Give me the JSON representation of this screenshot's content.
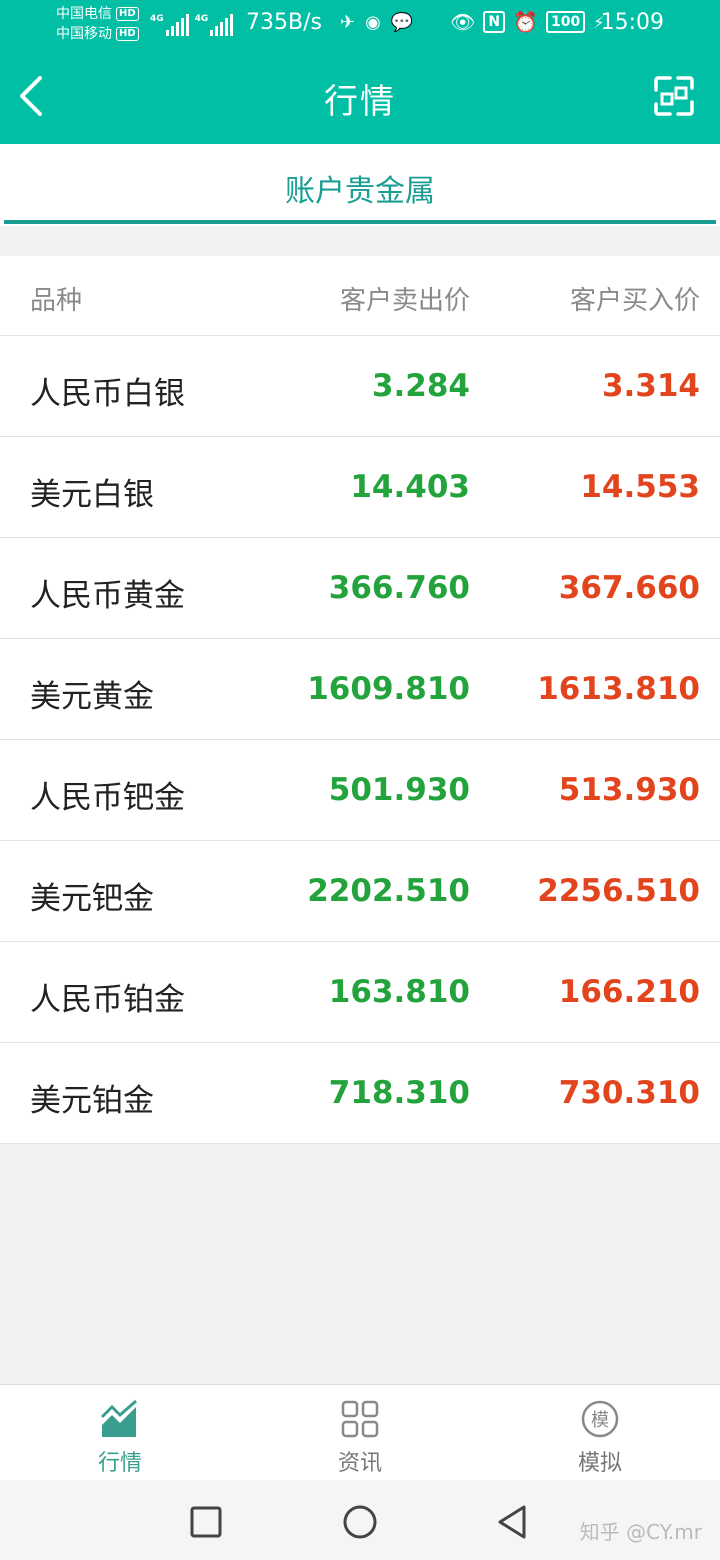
{
  "status_bar": {
    "carrier1": "中国电信",
    "carrier2": "中国移动",
    "hd_badge": "HD",
    "net_label": "4G",
    "net_speed": "735B/s",
    "battery": "100",
    "time": "15:09"
  },
  "header": {
    "title": "行情"
  },
  "tabs": {
    "active_label": "账户贵金属"
  },
  "table": {
    "columns": [
      "品种",
      "客户卖出价",
      "客户买入价"
    ],
    "rows": [
      {
        "name": "人民币白银",
        "sell": "3.284",
        "buy": "3.314"
      },
      {
        "name": "美元白银",
        "sell": "14.403",
        "buy": "14.553"
      },
      {
        "name": "人民币黄金",
        "sell": "366.760",
        "buy": "367.660"
      },
      {
        "name": "美元黄金",
        "sell": "1609.810",
        "buy": "1613.810"
      },
      {
        "name": "人民币钯金",
        "sell": "501.930",
        "buy": "513.930"
      },
      {
        "name": "美元钯金",
        "sell": "2202.510",
        "buy": "2256.510"
      },
      {
        "name": "人民币铂金",
        "sell": "163.810",
        "buy": "166.210"
      },
      {
        "name": "美元铂金",
        "sell": "718.310",
        "buy": "730.310"
      }
    ]
  },
  "bottom_nav": {
    "items": [
      {
        "label": "行情",
        "icon": "chart-icon",
        "active": true
      },
      {
        "label": "资讯",
        "icon": "grid-icon",
        "active": false
      },
      {
        "label": "模拟",
        "icon": "mo-badge-icon",
        "badge_char": "模",
        "active": false
      }
    ]
  },
  "watermark": "知乎 @CY.mr",
  "colors": {
    "brand": "#00bfa5",
    "tab_accent": "#1a9e93",
    "sell_green": "#23a33c",
    "buy_red": "#e2451d"
  }
}
